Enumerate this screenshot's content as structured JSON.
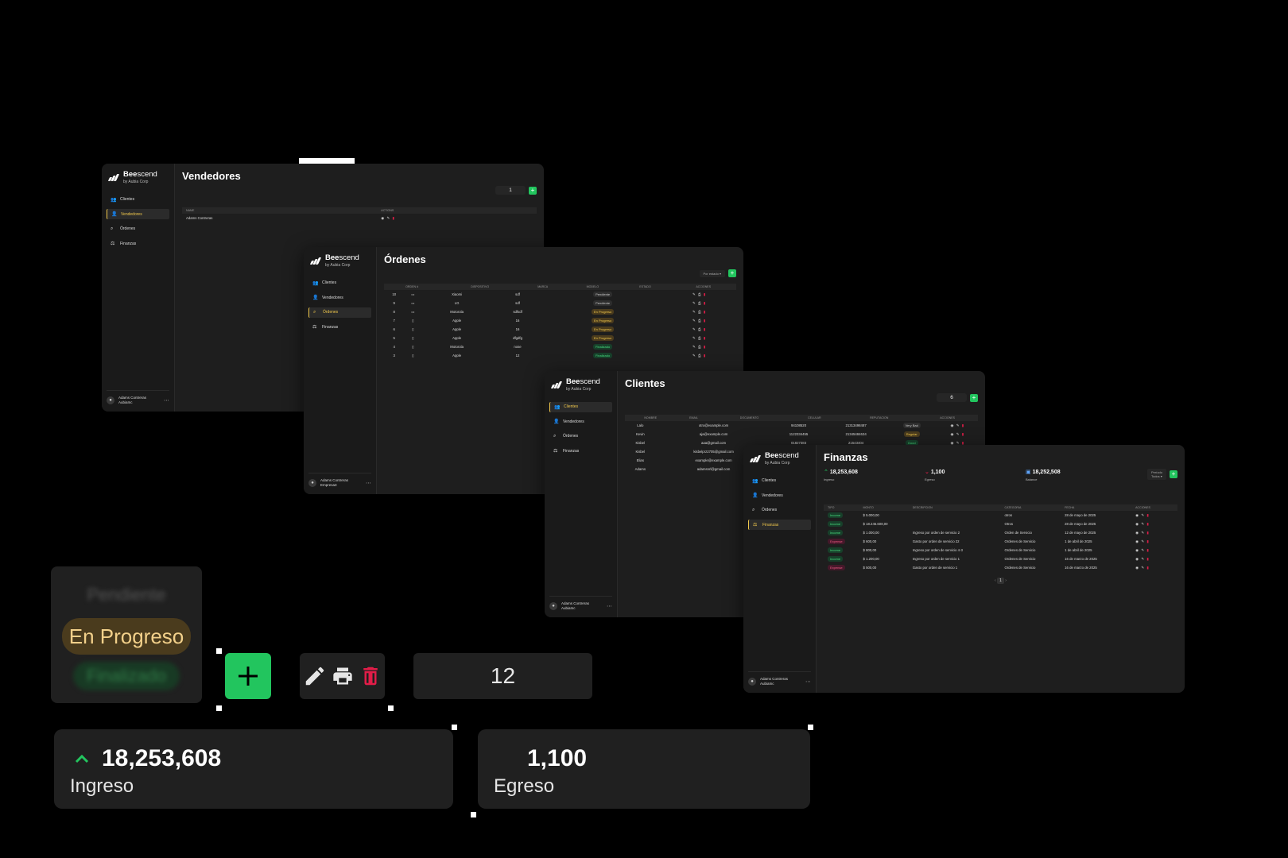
{
  "app": {
    "brand_main": "Bee",
    "brand_rest": "scend",
    "brand_sub": "by Aubia Corp"
  },
  "nav_labels": {
    "clientes": "Clientes",
    "vendedores": "Vendedores",
    "ordenes": "Órdenes",
    "finanzas": "Finanzas"
  },
  "vendedores_window": {
    "title": "Vendedores",
    "count": "1",
    "columns": [
      "NAME",
      "ACTIONS"
    ],
    "rows": [
      {
        "name": "Adams Contreras"
      }
    ],
    "user_name": "Adams Contreras",
    "user_company": "AubiaInc"
  },
  "ordenes_window": {
    "title": "Órdenes",
    "filter": "Por estado",
    "columns": [
      "ORDEN #",
      "DISPOSITIVO",
      "MARCA",
      "MODELO",
      "ESTADO",
      "ACCIONES"
    ],
    "rows": [
      {
        "orden": "10",
        "marca": "Xiaomi",
        "modelo": "sdf",
        "estado": "Pendiente"
      },
      {
        "orden": "9",
        "marca": "LG",
        "modelo": "sdf",
        "estado": "Pendiente"
      },
      {
        "orden": "8",
        "marca": "Motorola",
        "modelo": "sdfsdf",
        "estado": "En Progreso"
      },
      {
        "orden": "7",
        "marca": "Apple",
        "modelo": "16",
        "estado": "En Progreso"
      },
      {
        "orden": "6",
        "marca": "Apple",
        "modelo": "16",
        "estado": "En Progreso"
      },
      {
        "orden": "5",
        "marca": "Apple",
        "modelo": "dfgdfg",
        "estado": "En Progreso"
      },
      {
        "orden": "4",
        "marca": "Motorola",
        "modelo": "nose",
        "estado": "Finalizado"
      },
      {
        "orden": "3",
        "marca": "Apple",
        "modelo": "12",
        "estado": "Finalizado"
      }
    ],
    "user_name": "Adams Contreras",
    "user_company": "Empresa3"
  },
  "clientes_window": {
    "title": "Clientes",
    "count": "6",
    "columns": [
      "NOMBRE",
      "EMAIL",
      "DOCUMENTO",
      "CELULAR",
      "REPUTACION",
      "ACCIONES"
    ],
    "rows": [
      {
        "nombre": "Lalo",
        "email": "otro@example.com",
        "documento": "94108520",
        "celular": "21313498487",
        "reputacion": "Very Bad"
      },
      {
        "nombre": "Kevin",
        "email": "aja@example.com",
        "documento": "1122334455",
        "celular": "21345484634",
        "reputacion": "Regular"
      },
      {
        "nombre": "Kisbel",
        "email": "aaa@gmail.com",
        "documento": "01827383",
        "celular": "21543404",
        "reputacion": "Good"
      },
      {
        "nombre": "Kisbel",
        "email": "kisbelprz2705@gmail.com",
        "documento": "",
        "celular": "",
        "reputacion": ""
      },
      {
        "nombre": "Elias",
        "email": "example@example.com",
        "documento": "",
        "celular": "",
        "reputacion": ""
      },
      {
        "nombre": "Adams",
        "email": "adamsnrl@gmail.com",
        "documento": "",
        "celular": "",
        "reputacion": ""
      }
    ],
    "user_name": "Adams Contreras",
    "user_company": "AubiaInc"
  },
  "finanzas_window": {
    "title": "Finanzas",
    "ingresos": "18,253,608",
    "ingresos_label": "Ingreso",
    "egresos": "1,100",
    "egresos_label": "Egreso",
    "balance": "18,252,508",
    "balance_label": "Balance",
    "period_label": "Período",
    "period_value": "Todos",
    "columns": [
      "TIPO",
      "MONTO",
      "DESCRIPCION",
      "CATEGORIA",
      "FECHA",
      "ACCIONES"
    ],
    "rows": [
      {
        "tipo": "Income",
        "monto": "$ 5.000,00",
        "descripcion": "",
        "categoria": "otros",
        "fecha": "28 de mayo de 2025"
      },
      {
        "tipo": "Income",
        "monto": "$ 18.245.608,00",
        "descripcion": "",
        "categoria": "Otros",
        "fecha": "28 de mayo de 2025"
      },
      {
        "tipo": "Income",
        "monto": "$ 1.000,00",
        "descripcion": "Ingreso por orden de servicio 2",
        "categoria": "Orden de Servicio",
        "fecha": "12 de mayo de 2025"
      },
      {
        "tipo": "Expense",
        "monto": "$ 600,00",
        "descripcion": "Gasto por orden de servicio 22",
        "categoria": "Ordenes de Servicio",
        "fecha": "1 de abril de 2025"
      },
      {
        "tipo": "Income",
        "monto": "$ 800,00",
        "descripcion": "Ingreso por orden de servicio 4-3",
        "categoria": "Ordenes de Servicio",
        "fecha": "1 de abril de 2025"
      },
      {
        "tipo": "Income",
        "monto": "$ 1.200,00",
        "descripcion": "Ingreso por orden de servicio 1",
        "categoria": "Ordenes de Servicio",
        "fecha": "16 de marzo de 2025"
      },
      {
        "tipo": "Expense",
        "monto": "$ 500,00",
        "descripcion": "Gasto por orden de servicio 1",
        "categoria": "Ordenes de Servicio",
        "fecha": "16 de marzo de 2025"
      }
    ],
    "page": "1",
    "user_name": "Adams Contreras",
    "user_company": "AubiaInc"
  },
  "status_showcase": {
    "pendiente": "Pendiente",
    "en_progreso": "En Progreso",
    "finalizado": "Finalizado"
  },
  "add_button_label": "+",
  "counter_showcase": "12",
  "ingreso_card": {
    "value": "18,253,608",
    "label": "Ingreso"
  },
  "egreso_card": {
    "value": "1,100",
    "label": "Egreso"
  },
  "colors": {
    "accent": "#f2c94c",
    "add_green": "#22c55e",
    "delete_red": "#e11d48",
    "background": "#000000",
    "panel": "#1e1e1e"
  }
}
